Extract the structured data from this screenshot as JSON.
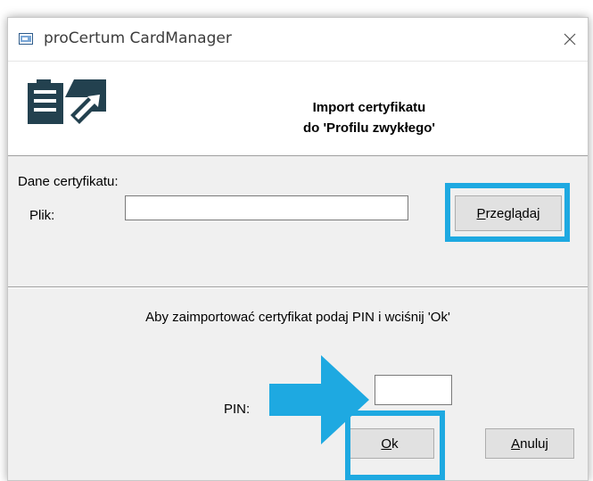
{
  "window": {
    "title": "proCertum CardManager"
  },
  "header": {
    "title_line1": "Import certyfikatu",
    "title_line2": "do 'Profilu zwykłego'"
  },
  "certificate_group": {
    "label": "Dane certyfikatu:",
    "file_label": "Plik:",
    "file_value": "",
    "browse_accel": "P",
    "browse_rest": "rzeglądaj"
  },
  "pin_section": {
    "instruction": "Aby zaimportować certyfikat podaj PIN i wciśnij 'Ok'",
    "pin_label": "PIN:",
    "pin_value": ""
  },
  "buttons": {
    "ok_accel": "O",
    "ok_rest": "k",
    "cancel_accel": "A",
    "cancel_rest": "nuluj"
  },
  "colors": {
    "highlight": "#1ea9e1",
    "dialog_bg": "#f0f0f0",
    "button_bg": "#e1e1e1"
  },
  "icons": {
    "title": "card-reader-icon",
    "header": "certificate-document-icon",
    "close": "close-icon",
    "pointer": "arrow-right-icon"
  }
}
